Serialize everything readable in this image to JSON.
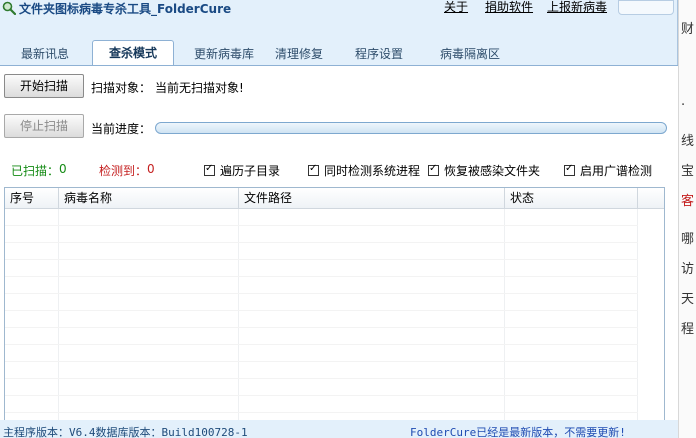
{
  "titlebar": {
    "title": "文件夹图标病毒专杀工具_FolderCure",
    "links": [
      "关于",
      "捐助软件",
      "上报新病毒"
    ]
  },
  "tabs": [
    {
      "label": "最新讯息",
      "active": false
    },
    {
      "label": "查杀模式",
      "active": true
    },
    {
      "label": "更新病毒库",
      "active": false
    },
    {
      "label": "清理修复",
      "active": false
    },
    {
      "label": "程序设置",
      "active": false
    },
    {
      "label": "病毒隔离区",
      "active": false
    }
  ],
  "scan": {
    "start_button": "开始扫描",
    "stop_button": "停止扫描",
    "target_label": "扫描对象：",
    "target_value": "当前无扫描对象!",
    "progress_label": "当前进度：",
    "progress": 0
  },
  "counters": {
    "scanned_label": "已扫描：",
    "scanned_value": "0",
    "detected_label": "检测到：",
    "detected_value": "0"
  },
  "options": [
    {
      "label": "遍历子目录",
      "checked": true
    },
    {
      "label": "同时检测系统进程",
      "checked": true
    },
    {
      "label": "恢复被感染文件夹",
      "checked": true
    },
    {
      "label": "启用广谱检测",
      "checked": true
    }
  ],
  "table": {
    "columns": [
      "序号",
      "病毒名称",
      "文件路径",
      "状态"
    ],
    "rows": []
  },
  "statusbar": {
    "left": "主程序版本：V6.4数据库版本：Build100728-1",
    "right": "FolderCure已经是最新版本，不需要更新!"
  },
  "side": {
    "fragments": [
      "财",
      "·",
      "线",
      "宝",
      "客",
      "哪",
      "访",
      "天",
      "程"
    ]
  },
  "colors": {
    "scanned": "#138a13",
    "detected": "#c41e1e",
    "accent": "#1a4a84"
  }
}
